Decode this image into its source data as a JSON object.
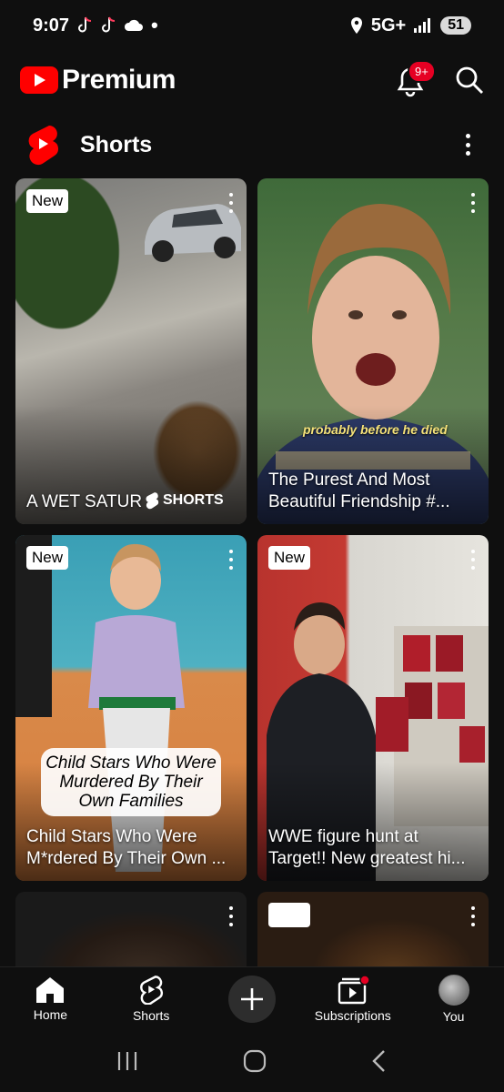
{
  "status": {
    "time": "9:07",
    "network": "5G+",
    "battery": "51"
  },
  "app": {
    "logo_text": "Premium",
    "notification_badge": "9+"
  },
  "section": {
    "title": "Shorts"
  },
  "cards": [
    {
      "title": "A WET SATUR",
      "tag": "New",
      "watermark": "SHORTS"
    },
    {
      "title": "The Purest And Most Beautiful Friendship  #...",
      "caption": "probably before he died"
    },
    {
      "title": "Child Stars Who Were M*rdered By Their Own ...",
      "tag": "New",
      "overlay": "Child Stars Who Were Murdered By Their Own Families"
    },
    {
      "title": "WWE figure hunt at Target!! New greatest hi...",
      "tag": "New"
    }
  ],
  "nav": [
    {
      "label": "Home",
      "icon": "home-icon"
    },
    {
      "label": "Shorts",
      "icon": "shorts-icon"
    },
    {
      "label": "",
      "icon": "create-plus-icon"
    },
    {
      "label": "Subscriptions",
      "icon": "subscriptions-icon"
    },
    {
      "label": "You",
      "icon": "avatar"
    }
  ],
  "colors": {
    "background": "#0f0f0f",
    "brand_red": "#ff0000",
    "badge_red": "#e60023"
  }
}
